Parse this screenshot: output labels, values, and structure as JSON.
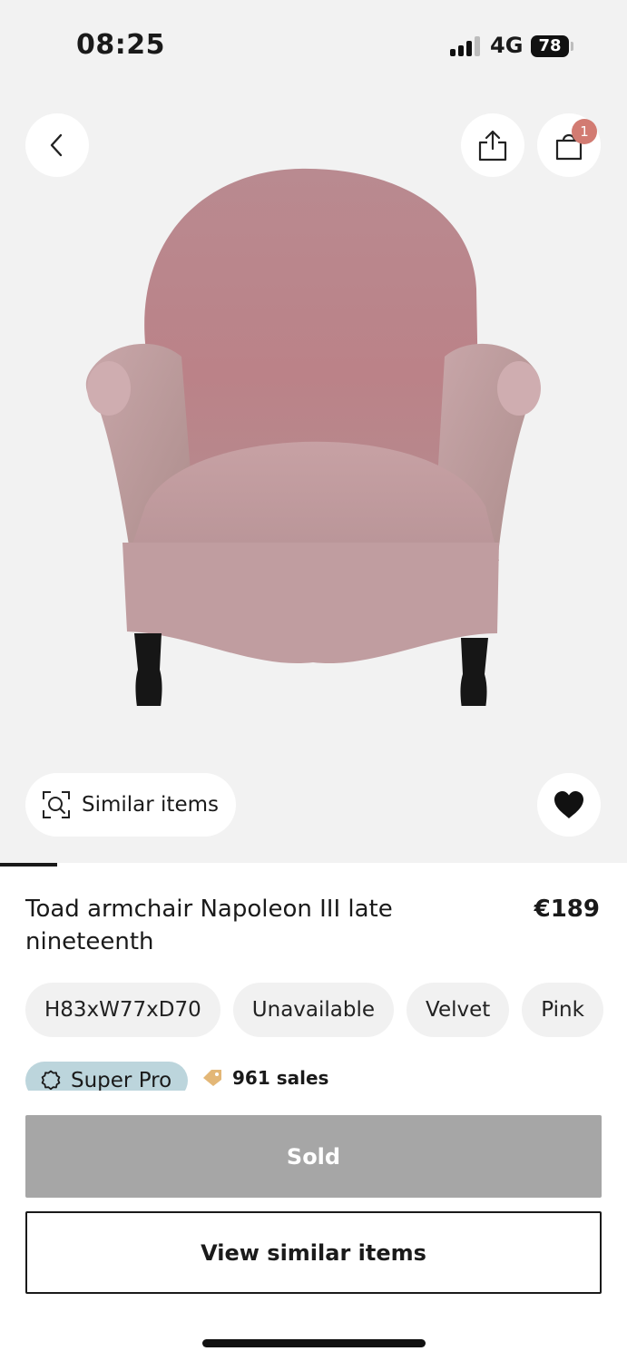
{
  "status_bar": {
    "time": "08:25",
    "network": "4G",
    "battery": "78",
    "signal_bars_active": 3,
    "signal_bars_total": 4
  },
  "header": {
    "back_icon": "chevron-left-icon",
    "share_icon": "share-icon",
    "cart_icon": "shopping-bag-icon",
    "cart_count": "1"
  },
  "hero": {
    "similar_items_label": "Similar items",
    "similar_icon": "visual-search-icon",
    "favorite_icon": "heart-icon",
    "pager_active_index": 0
  },
  "product": {
    "title": "Toad armchair Napoleon III late nineteenth",
    "price": "€189",
    "attributes": [
      "H83xW77xD70",
      "Unavailable",
      "Velvet",
      "Pink"
    ]
  },
  "seller": {
    "badge_label": "Super Pro",
    "badge_icon": "seal-icon",
    "sales_icon": "tag-icon",
    "sales_label": "961 sales"
  },
  "actions": {
    "sold_label": "Sold",
    "view_similar_label": "View similar items"
  },
  "colors": {
    "sold_button": "#a6a6a6",
    "badge_bg": "#bcd5dc",
    "cart_badge": "#d27b72",
    "hero_bg": "#f2f2f2"
  }
}
